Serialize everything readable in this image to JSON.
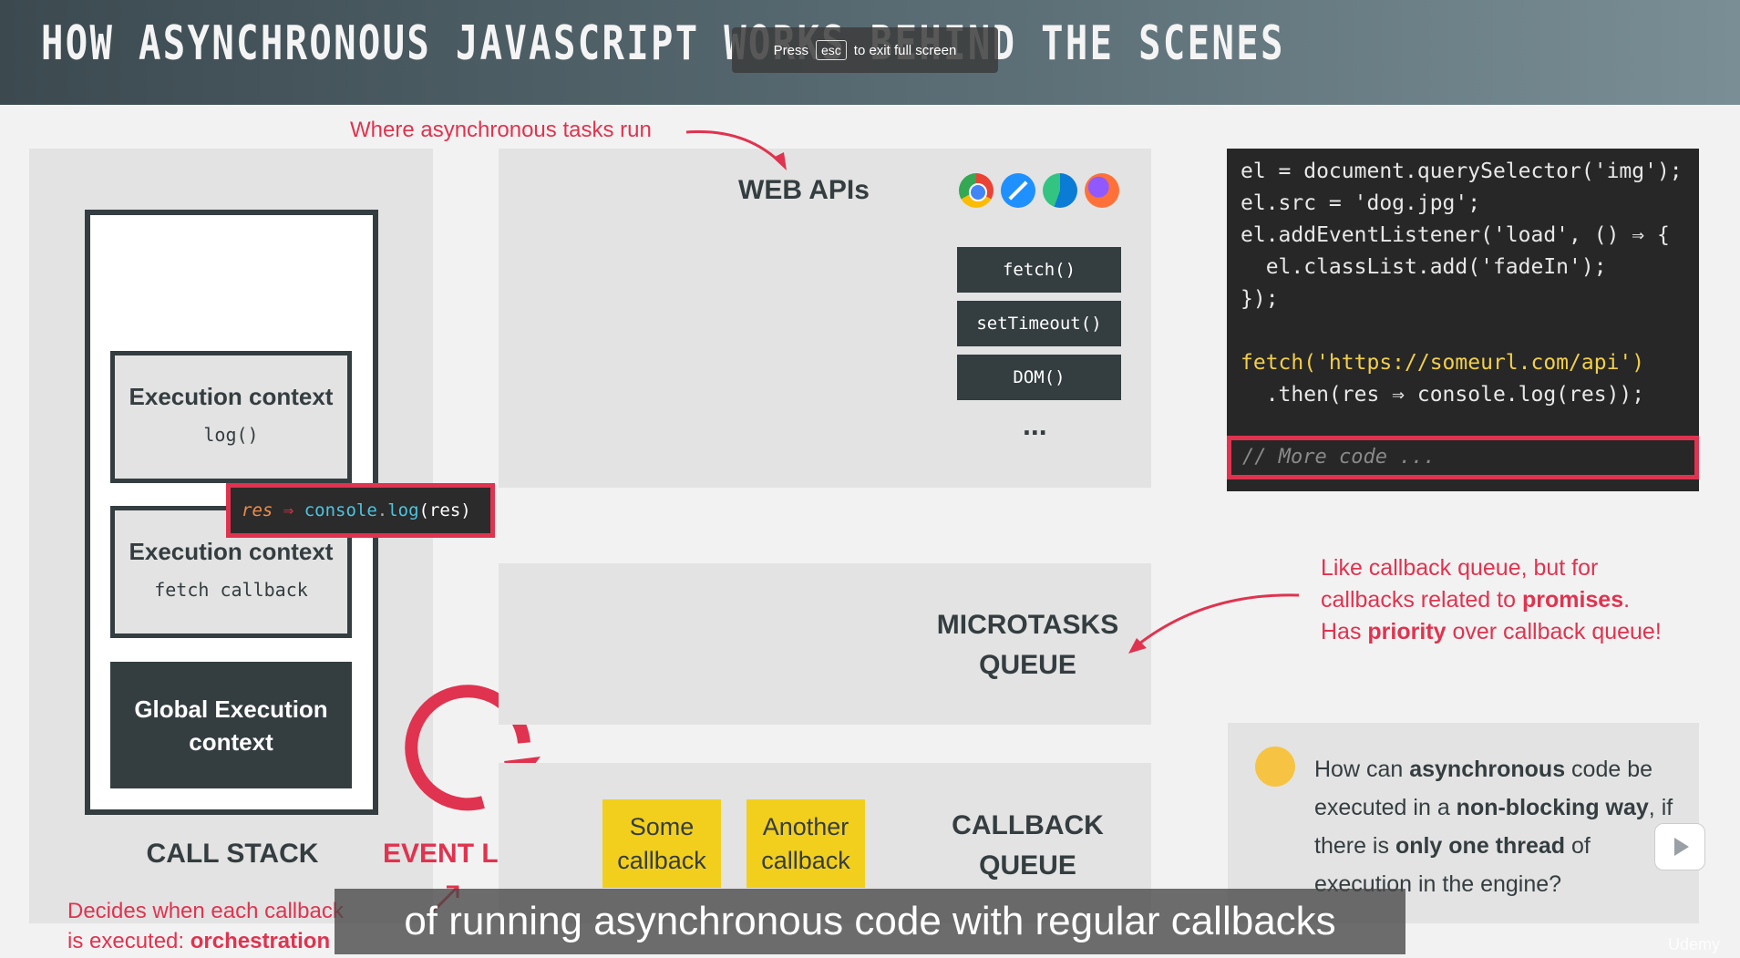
{
  "header": {
    "title": "HOW ASYNCHRONOUS JAVASCRIPT WORKS BEHIND THE SCENES",
    "fullscreen_notice": {
      "press": "Press",
      "key": "esc",
      "rest": "to exit full screen"
    }
  },
  "annotations": {
    "where_tasks_run": "Where asynchronous tasks run",
    "microtasks_note": [
      "Like callback queue, but for",
      "callbacks related to ",
      "promises",
      ".",
      "Has ",
      "priority",
      " over callback queue!"
    ],
    "event_loop_note_line1_pre": "Decides when each callback",
    "event_loop_note_line2_pre": "is executed: ",
    "event_loop_note_line2_bold": "orchestration"
  },
  "call_stack": {
    "label": "CALL STACK",
    "contexts": [
      {
        "title": "Execution context",
        "sub": "log()"
      },
      {
        "title": "Execution context",
        "sub": "fetch callback"
      }
    ],
    "global": "Global Execution context",
    "chip": {
      "param": "res",
      "arrow": "⇒",
      "obj": "console",
      "dot": ".",
      "fn": "log",
      "args": "(res)"
    }
  },
  "event_loop": {
    "label": "EVENT LOOP"
  },
  "web_apis": {
    "title": "WEB APIs",
    "browsers": [
      "chrome-icon",
      "safari-icon",
      "edge-icon",
      "firefox-icon"
    ],
    "items": [
      "fetch()",
      "setTimeout()",
      "DOM()"
    ],
    "more": "..."
  },
  "microtasks_queue": {
    "label_line1": "MICROTASKS",
    "label_line2": "QUEUE"
  },
  "callback_queue": {
    "label_line1": "CALLBACK",
    "label_line2": "QUEUE",
    "items": [
      {
        "line1": "Some",
        "line2": "callback"
      },
      {
        "line1": "Another",
        "line2": "callback"
      }
    ]
  },
  "code": {
    "lines": [
      "el = document.querySelector('img');",
      "el.src = 'dog.jpg';",
      "el.addEventListener('load', () ⇒ {",
      "  el.classList.add('fadeIn');",
      "});",
      "",
      "fetch('https://someurl.com/api')",
      "  .then(res ⇒ console.log(res));"
    ],
    "more_code": "// More code ..."
  },
  "question": {
    "parts": [
      "How can ",
      "asynchronous",
      " code be executed in a ",
      "non-blocking way",
      ", if there is ",
      "only one thread",
      " of execution in the engine?"
    ]
  },
  "caption": "of running asynchronous code with regular callbacks",
  "watermark": "Udemy",
  "colors": {
    "accent_red": "#e0334f",
    "dark": "#343d40",
    "yellow": "#f2cf1c",
    "panel": "#e3e3e3"
  }
}
